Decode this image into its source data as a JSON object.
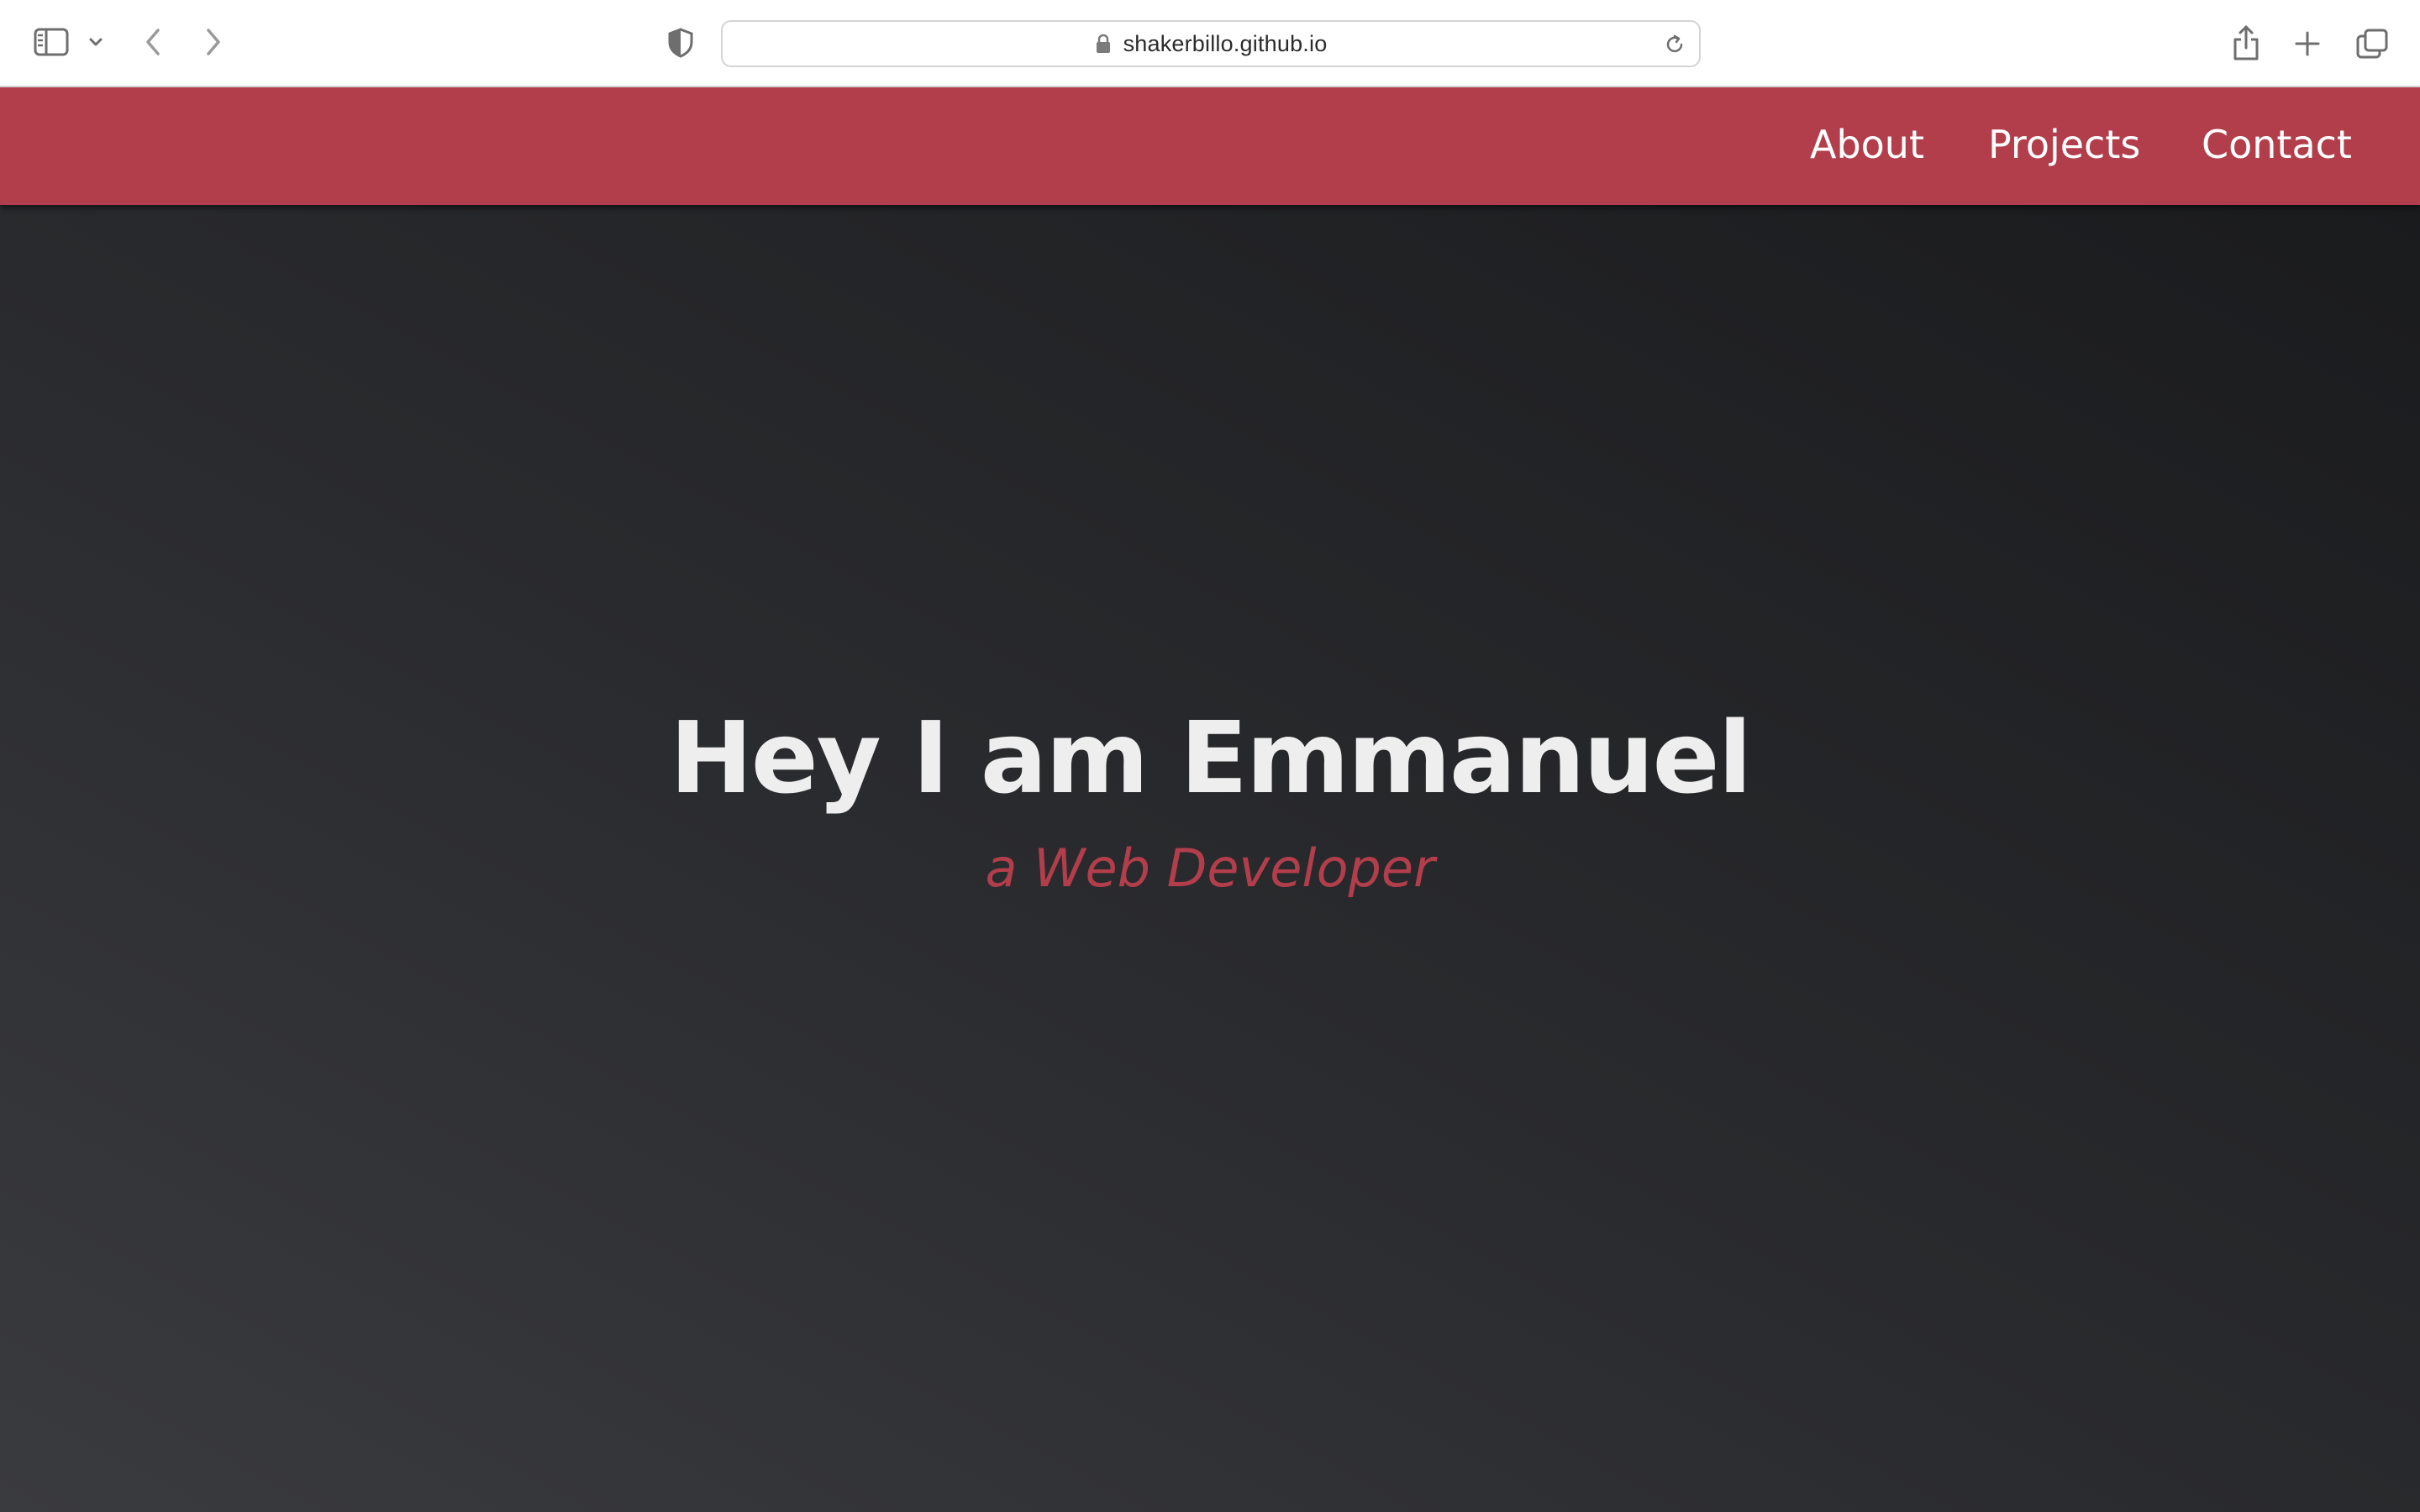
{
  "browser": {
    "url": "shakerbillo.github.io",
    "icons": {
      "sidebar": "sidebar-icon",
      "sidebar_menu": "chevron-down-icon",
      "back": "chevron-left-icon",
      "forward": "chevron-right-icon",
      "privacy": "shield-icon",
      "lock": "lock-icon",
      "reload": "reload-icon",
      "share": "share-icon",
      "new_tab": "plus-icon",
      "tab_overview": "tabs-icon"
    }
  },
  "nav": {
    "links": [
      {
        "label": "About"
      },
      {
        "label": "Projects"
      },
      {
        "label": "Contact"
      }
    ]
  },
  "hero": {
    "title": "Hey I am Emmanuel",
    "subtitle": "a Web Developer"
  },
  "colors": {
    "accent": "#b23e4b",
    "hero_text": "#eeeeee",
    "hero_bg_dark": "#1a1b1d",
    "hero_bg_light": "#3a3b3f"
  }
}
